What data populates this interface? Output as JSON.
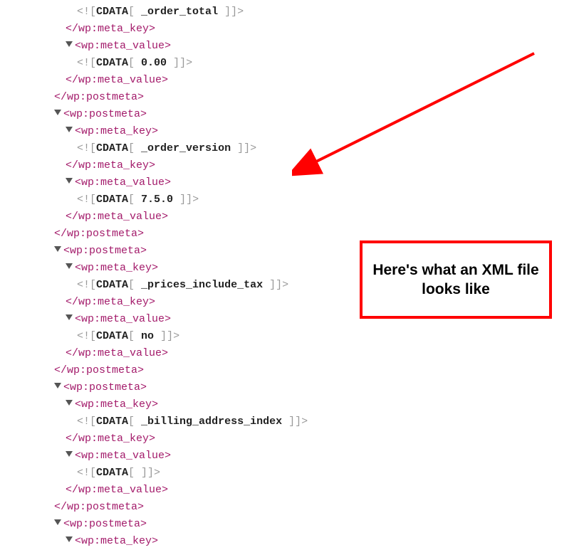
{
  "xml": {
    "lines": [
      {
        "indent": 3,
        "type": "cdata",
        "content": "_order_total"
      },
      {
        "indent": 2,
        "type": "close",
        "content": "wp:meta_key"
      },
      {
        "indent": 2,
        "type": "open",
        "content": "wp:meta_value"
      },
      {
        "indent": 3,
        "type": "cdata",
        "content": "0.00"
      },
      {
        "indent": 2,
        "type": "close",
        "content": "wp:meta_value"
      },
      {
        "indent": 1,
        "type": "close",
        "content": "wp:postmeta"
      },
      {
        "indent": 1,
        "type": "open",
        "content": "wp:postmeta"
      },
      {
        "indent": 2,
        "type": "open",
        "content": "wp:meta_key"
      },
      {
        "indent": 3,
        "type": "cdata",
        "content": "_order_version"
      },
      {
        "indent": 2,
        "type": "close",
        "content": "wp:meta_key"
      },
      {
        "indent": 2,
        "type": "open",
        "content": "wp:meta_value"
      },
      {
        "indent": 3,
        "type": "cdata",
        "content": "7.5.0"
      },
      {
        "indent": 2,
        "type": "close",
        "content": "wp:meta_value"
      },
      {
        "indent": 1,
        "type": "close",
        "content": "wp:postmeta"
      },
      {
        "indent": 1,
        "type": "open",
        "content": "wp:postmeta"
      },
      {
        "indent": 2,
        "type": "open",
        "content": "wp:meta_key"
      },
      {
        "indent": 3,
        "type": "cdata",
        "content": "_prices_include_tax"
      },
      {
        "indent": 2,
        "type": "close",
        "content": "wp:meta_key"
      },
      {
        "indent": 2,
        "type": "open",
        "content": "wp:meta_value"
      },
      {
        "indent": 3,
        "type": "cdata",
        "content": "no"
      },
      {
        "indent": 2,
        "type": "close",
        "content": "wp:meta_value"
      },
      {
        "indent": 1,
        "type": "close",
        "content": "wp:postmeta"
      },
      {
        "indent": 1,
        "type": "open",
        "content": "wp:postmeta"
      },
      {
        "indent": 2,
        "type": "open",
        "content": "wp:meta_key"
      },
      {
        "indent": 3,
        "type": "cdata",
        "content": "_billing_address_index"
      },
      {
        "indent": 2,
        "type": "close",
        "content": "wp:meta_key"
      },
      {
        "indent": 2,
        "type": "open",
        "content": "wp:meta_value"
      },
      {
        "indent": 3,
        "type": "cdata",
        "content": ""
      },
      {
        "indent": 2,
        "type": "close",
        "content": "wp:meta_value"
      },
      {
        "indent": 1,
        "type": "close",
        "content": "wp:postmeta"
      },
      {
        "indent": 1,
        "type": "open",
        "content": "wp:postmeta"
      },
      {
        "indent": 2,
        "type": "open",
        "content": "wp:meta_key"
      }
    ]
  },
  "callout": {
    "text": "Here's what an XML file looks like"
  }
}
